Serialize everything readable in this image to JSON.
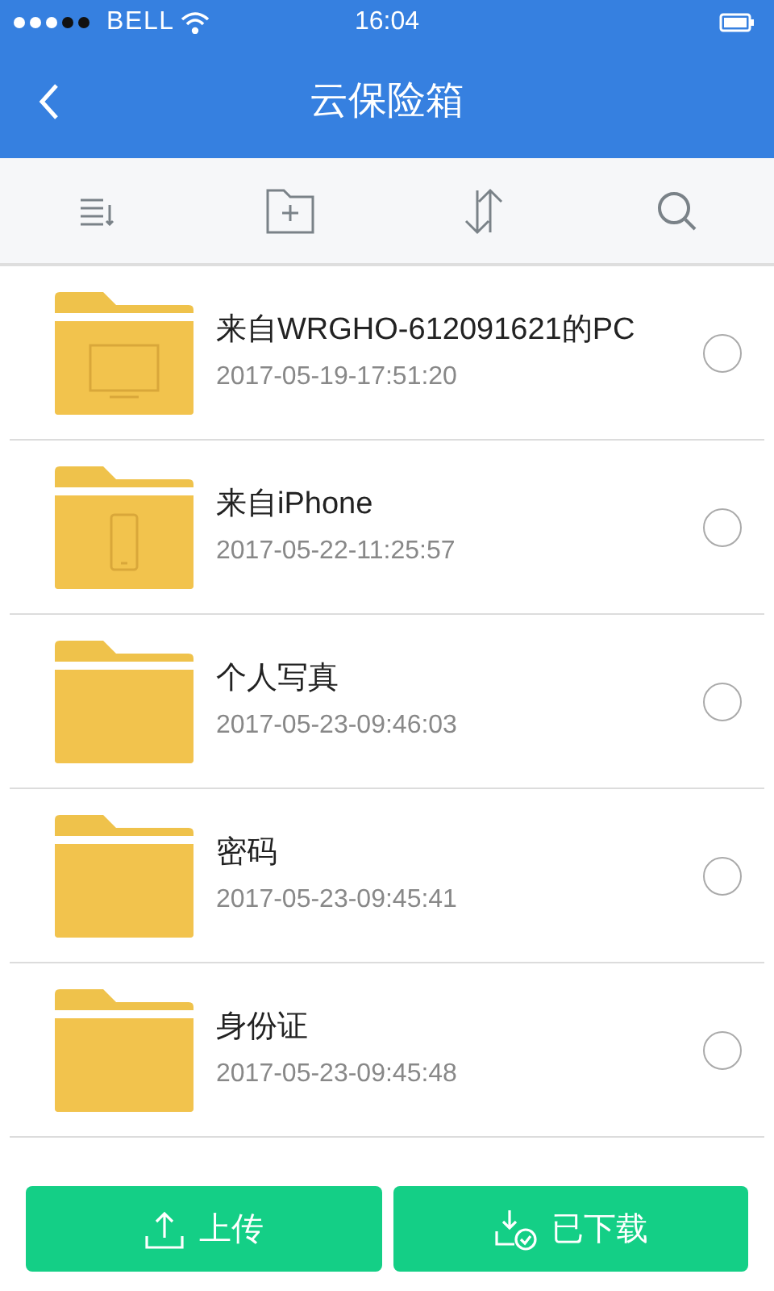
{
  "status_bar": {
    "carrier": "BELL",
    "time": "16:04"
  },
  "nav": {
    "title": "云保险箱"
  },
  "files": [
    {
      "kind": "pc",
      "name": "来自WRGHO-612091621的PC",
      "date": "2017-05-19-17:51:20",
      "selected": false
    },
    {
      "kind": "phone",
      "name": "来自iPhone",
      "date": "2017-05-22-11:25:57",
      "selected": false
    },
    {
      "kind": "plain",
      "name": "个人写真",
      "date": "2017-05-23-09:46:03",
      "selected": false
    },
    {
      "kind": "plain",
      "name": "密码",
      "date": "2017-05-23-09:45:41",
      "selected": false
    },
    {
      "kind": "plain",
      "name": "身份证",
      "date": "2017-05-23-09:45:48",
      "selected": false
    }
  ],
  "buttons": [
    {
      "kind": "upload",
      "label": "上传"
    },
    {
      "kind": "downloaded",
      "label": "已下载"
    }
  ]
}
